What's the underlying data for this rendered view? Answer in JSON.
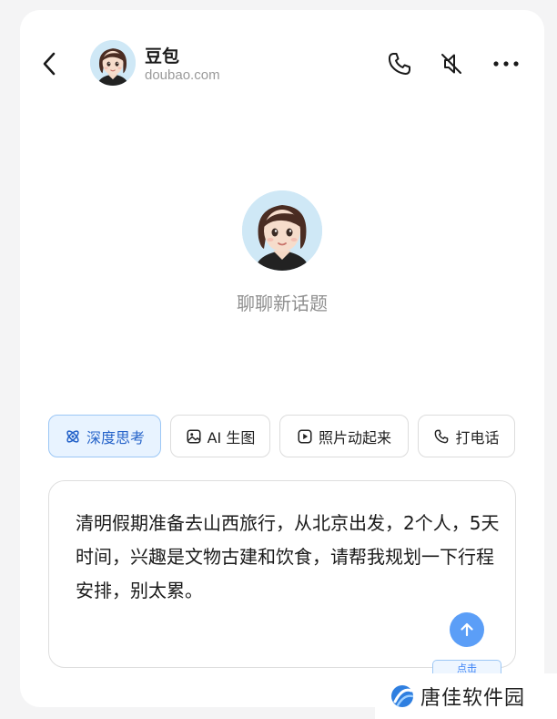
{
  "header": {
    "name": "豆包",
    "domain": "doubao.com"
  },
  "main": {
    "new_topic_label": "聊聊新话题"
  },
  "chips": [
    {
      "label": "深度思考",
      "icon": "atom-icon",
      "active": true
    },
    {
      "label": "AI 生图",
      "icon": "image-icon",
      "active": false
    },
    {
      "label": "照片动起来",
      "icon": "play-icon",
      "active": false
    },
    {
      "label": "打电话",
      "icon": "phone-icon",
      "active": false
    }
  ],
  "composer": {
    "text": "清明假期准备去山西旅行，从北京出发，2个人，5天时间，兴趣是文物古建和饮食，请帮我规划一下行程安排，别太累。",
    "tooltip": "点击"
  },
  "watermark": {
    "text": "唐佳软件园"
  },
  "colors": {
    "accent": "#5b9ef7",
    "chip_active_bg": "#e8f3ff",
    "chip_active_text": "#2563c9"
  }
}
